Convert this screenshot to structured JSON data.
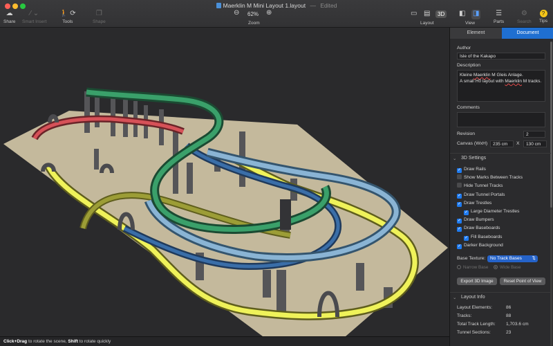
{
  "window": {
    "title": "Maerklin M Mini Layout 1.layout",
    "status": "Edited"
  },
  "toolbar": {
    "share": "Share",
    "smart_insert": "Smart Insert",
    "tools": "Tools",
    "shape": "Shape",
    "zoom_value": "62%",
    "zoom": "Zoom",
    "mode_3d": "3D",
    "layout": "Layout",
    "view": "View",
    "parts": "Parts",
    "search": "Search",
    "tips": "Tips"
  },
  "statusbar": {
    "key1": "Click+Drag",
    "text1": " to rotate the scene, ",
    "key2": "Shift",
    "text2": " to rotate quickly"
  },
  "inspector": {
    "tabs": [
      "Element",
      "Document"
    ],
    "author_label": "Author",
    "author_value": "Isle of the Kakapo",
    "description_label": "Description",
    "description_lines": [
      "Kleine Maerklin M Gleis Anlage.",
      "",
      "A small H0 layout with Maerklin M tracks."
    ],
    "comments_label": "Comments",
    "revision_label": "Revision",
    "revision_value": "2",
    "canvas_label": "Canvas (WxH)",
    "canvas_w": "235 cm",
    "canvas_x": "X",
    "canvas_h": "130 cm",
    "settings_title": "3D Settings",
    "checkboxes": [
      {
        "label": "Draw Rails",
        "checked": true
      },
      {
        "label": "Show Marks Between Tracks",
        "checked": false
      },
      {
        "label": "Hide Tunnel Tracks",
        "checked": false
      },
      {
        "label": "Draw Tunnel Portals",
        "checked": true
      },
      {
        "label": "Draw Trestles",
        "checked": true
      },
      {
        "label": "Large Diameter Trestles",
        "checked": true
      },
      {
        "label": "Draw Bumpers",
        "checked": true
      },
      {
        "label": "Draw Baseboards",
        "checked": true
      },
      {
        "label": "Fill Baseboards",
        "checked": true
      },
      {
        "label": "Darker Background",
        "checked": true
      }
    ],
    "base_texture_label": "Base Texture:",
    "base_texture_value": "No Track Bases",
    "narrow_base": "Narrow Base",
    "wide_base": "Wide Base",
    "export_button": "Export 3D Image",
    "reset_button": "Reset Point of View",
    "layout_info_title": "Layout Info",
    "info": [
      {
        "label": "Layout Elements:",
        "value": "86"
      },
      {
        "label": "Tracks:",
        "value": "88"
      },
      {
        "label": "Total Track Length:",
        "value": "1,703.6 cm"
      },
      {
        "label": "Tunnel Sections:",
        "value": "23"
      }
    ]
  },
  "colors": {
    "accent": "#1f6fd1",
    "track_red": "#c8474e",
    "track_green": "#2e8f5a",
    "track_yellow": "#e6e84a",
    "track_blue": "#3b6fa8",
    "track_lightblue": "#7fb0d8",
    "baseboard": "#c8bda0"
  }
}
